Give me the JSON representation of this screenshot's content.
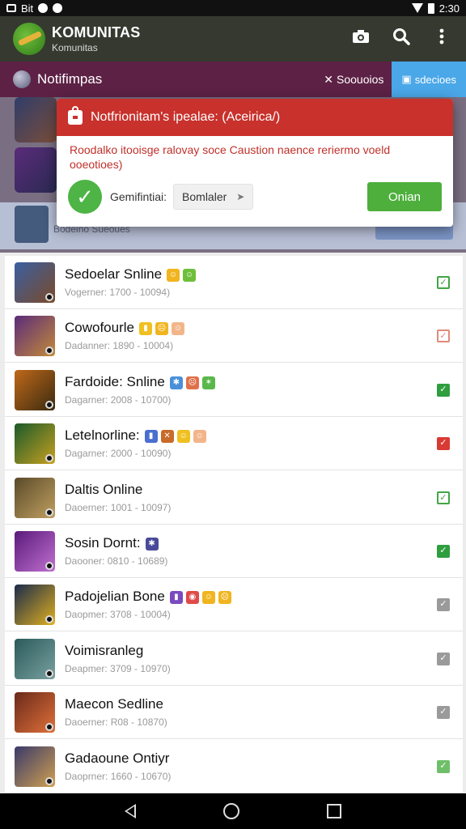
{
  "status_bar": {
    "left_text": "Bit",
    "time": "2:30"
  },
  "app_bar": {
    "title": "KOMUNITAS",
    "subtitle": "Komunitas"
  },
  "notif_bar": {
    "title": "Notifimpas",
    "dismiss_label": "Soouoios",
    "filter_label": "sdecioes"
  },
  "dimmed_row_text": "Bodeino Sueoues",
  "modal": {
    "title": "Notfrionitam's ipealae: (Aceirica/)",
    "message": "Roodalko itooisge ralovay soce Caustion naence reriermo voeld ooeotioes)",
    "confirm_label": "Gemifintiai:",
    "chip_label": "Bomlaler",
    "primary_label": "Onian"
  },
  "items": [
    {
      "name": "Sedoelar Snline",
      "meta": "Vogerner: 1700 - 10094)",
      "emojis": [
        {
          "c": "#f0b51f",
          "g": "☺"
        },
        {
          "c": "#6fbf3a",
          "g": "☺"
        }
      ],
      "check": {
        "color": "#41a546",
        "style": "outline"
      },
      "thumb": [
        "#3a5fa0",
        "#7a4a2a"
      ]
    },
    {
      "name": "Cowofourle",
      "meta": "Dadanner: 1890 - 10004)",
      "emojis": [
        {
          "c": "#f0c020",
          "g": "▮"
        },
        {
          "c": "#f0b51f",
          "g": "☹"
        },
        {
          "c": "#f2b58a",
          "g": "☺"
        }
      ],
      "check": {
        "color": "#e08a7a",
        "style": "outline"
      },
      "thumb": [
        "#5a2b7a",
        "#c48a3a"
      ]
    },
    {
      "name": "Fardoide: Snline",
      "meta": "Dagarner: 2008 - 10700)",
      "emojis": [
        {
          "c": "#4a90d9",
          "g": "✱"
        },
        {
          "c": "#e0704a",
          "g": "☹"
        },
        {
          "c": "#5ab84a",
          "g": "✶"
        }
      ],
      "check": {
        "color": "#2f9e3f",
        "style": "filled"
      },
      "thumb": [
        "#c0691a",
        "#3a2a10"
      ]
    },
    {
      "name": "Letelnorline:",
      "meta": "Dagarner: 2000 - 10090)",
      "emojis": [
        {
          "c": "#4a6fd0",
          "g": "▮"
        },
        {
          "c": "#c86a2a",
          "g": "✕"
        },
        {
          "c": "#f0c020",
          "g": "☺"
        },
        {
          "c": "#f2b58a",
          "g": "☺"
        }
      ],
      "check": {
        "color": "#d93a33",
        "style": "filled"
      },
      "thumb": [
        "#1a5a2a",
        "#c8a020"
      ]
    },
    {
      "name": "Daltis Online",
      "meta": "Daoerner: 1001 - 10097)",
      "emojis": [],
      "check": {
        "color": "#41a546",
        "style": "outline"
      },
      "thumb": [
        "#5a4a2a",
        "#c0a060"
      ]
    },
    {
      "name": "Sosin Dornt:",
      "meta": "Daooner: 0810 - 10689)",
      "emojis": [
        {
          "c": "#4a4a9a",
          "g": "✱"
        }
      ],
      "check": {
        "color": "#2f9e3f",
        "style": "filled"
      },
      "thumb": [
        "#5a1a7a",
        "#c070d0"
      ]
    },
    {
      "name": "Padojelian Bone",
      "meta": "Daopmer: 3708 - 10004)",
      "emojis": [
        {
          "c": "#7a4ac0",
          "g": "▮"
        },
        {
          "c": "#e04a4a",
          "g": "◉"
        },
        {
          "c": "#f0b51f",
          "g": "☺"
        },
        {
          "c": "#f0b51f",
          "g": "☹"
        }
      ],
      "check": {
        "color": "#9a9a9a",
        "style": "filled"
      },
      "thumb": [
        "#1a2a4a",
        "#e0b020"
      ]
    },
    {
      "name": "Voimisranleg",
      "meta": "Deapmer: 3709 - 10970)",
      "emojis": [],
      "check": {
        "color": "#9a9a9a",
        "style": "filled"
      },
      "thumb": [
        "#2a5a5a",
        "#7aa0a0"
      ]
    },
    {
      "name": "Maecon Sedline",
      "meta": "Daoerner: R08 - 10870)",
      "emojis": [],
      "check": {
        "color": "#9a9a9a",
        "style": "filled"
      },
      "thumb": [
        "#6a2a1a",
        "#e0703a"
      ]
    },
    {
      "name": "Gadaoune Ontiyr",
      "meta": "Daoprner: 1660 - 10670)",
      "emojis": [],
      "check": {
        "color": "#6fbf6a",
        "style": "filled"
      },
      "thumb": [
        "#3a3a6a",
        "#d0a050"
      ]
    }
  ]
}
